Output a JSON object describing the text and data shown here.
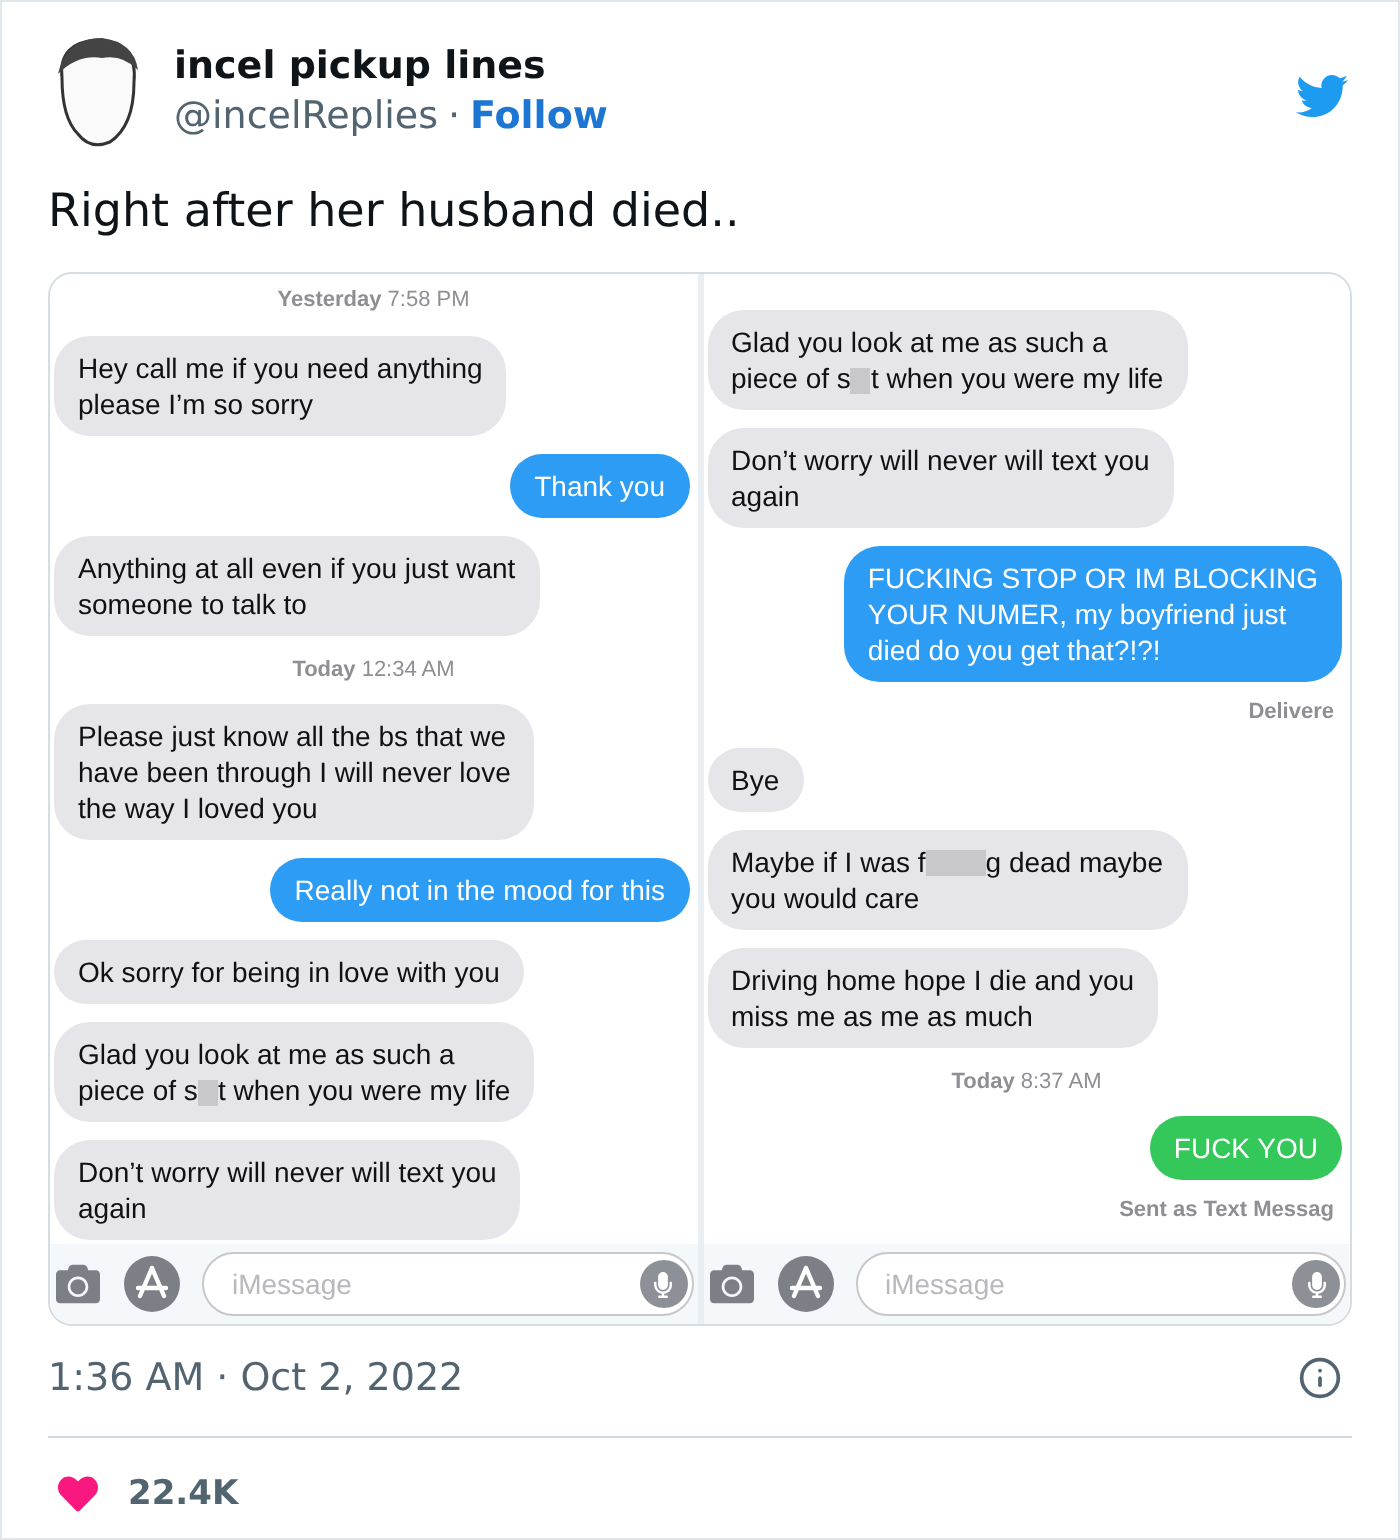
{
  "tweet": {
    "author": {
      "name": "incel pickup lines",
      "handle": "@incelReplies",
      "separator": "·",
      "follow": "Follow"
    },
    "text": "Right after her husband died..",
    "screenshot": {
      "panels": [
        {
          "messages": [
            {
              "kind": "time",
              "text": "**Yesterday** 7:58 PM"
            },
            {
              "kind": "received",
              "parts": [
                {
                  "kind": "text",
                  "text": "Hey call me if you need anything\nplease I’m so sorry"
                }
              ]
            },
            {
              "kind": "sent_imessage",
              "parts": [
                {
                  "kind": "text",
                  "text": "Thank you"
                }
              ]
            },
            {
              "kind": "received",
              "parts": [
                {
                  "kind": "text",
                  "text": "Anything at all even if you just want\nsomeone to talk to"
                }
              ]
            },
            {
              "kind": "time",
              "text": "**Today** 12:34 AM"
            },
            {
              "kind": "received",
              "parts": [
                {
                  "kind": "text",
                  "text": "Please just know all the bs that we\nhave been through I will never love\nthe way I loved you"
                }
              ]
            },
            {
              "kind": "sent_imessage",
              "parts": [
                {
                  "kind": "text",
                  "text": "Really not in the mood for this"
                }
              ]
            },
            {
              "kind": "received",
              "parts": [
                {
                  "kind": "text",
                  "text": "Ok sorry for being in love with you"
                }
              ]
            },
            {
              "kind": "received",
              "parts": [
                {
                  "kind": "text",
                  "text": "Glad you look at me as such a\npiece of s"
                },
                {
                  "kind": "censor_short"
                },
                {
                  "kind": "text",
                  "text": "t when you were my life"
                }
              ]
            },
            {
              "kind": "received",
              "parts": [
                {
                  "kind": "text",
                  "text": "Don’t worry will never will text you\nagain"
                }
              ]
            }
          ],
          "composer": {
            "placeholder": "iMessage"
          }
        },
        {
          "messages": [
            {
              "kind": "received",
              "parts": [
                {
                  "kind": "text",
                  "text": "Glad you look at me as such a\npiece of s"
                },
                {
                  "kind": "censor_short"
                },
                {
                  "kind": "text",
                  "text": "t when you were my life"
                }
              ]
            },
            {
              "kind": "received",
              "parts": [
                {
                  "kind": "text",
                  "text": "Don’t worry will never will text you\nagain"
                }
              ]
            },
            {
              "kind": "sent_imessage",
              "parts": [
                {
                  "kind": "text",
                  "text": "FUCKING STOP OR IM BLOCKING\nYOUR NUMER, my boyfriend just\ndied do you get that?!?!"
                }
              ]
            },
            {
              "kind": "status",
              "text": "Delivere"
            },
            {
              "kind": "received",
              "parts": [
                {
                  "kind": "text",
                  "text": "Bye"
                }
              ]
            },
            {
              "kind": "received",
              "parts": [
                {
                  "kind": "text",
                  "text": "Maybe if I was f"
                },
                {
                  "kind": "censor_long"
                },
                {
                  "kind": "text",
                  "text": "g dead maybe\nyou would care"
                }
              ]
            },
            {
              "kind": "received",
              "parts": [
                {
                  "kind": "text",
                  "text": "Driving home hope I die and you\nmiss me as me as much"
                }
              ]
            },
            {
              "kind": "time",
              "text": "**Today** 8:37 AM"
            },
            {
              "kind": "sent_sms",
              "parts": [
                {
                  "kind": "text",
                  "text": "FUCK YOU"
                }
              ]
            },
            {
              "kind": "status",
              "text": "Sent as Text Messag"
            }
          ],
          "composer": {
            "placeholder": "iMessage"
          }
        }
      ]
    },
    "timestamp": "1:36 AM · Oct 2, 2022",
    "likes": "22.4K"
  }
}
